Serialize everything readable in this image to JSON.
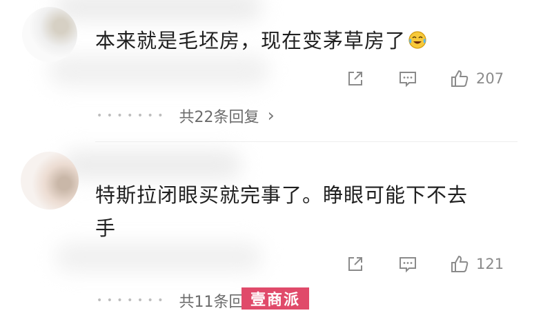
{
  "comments": [
    {
      "text": "本来就是毛坯房，现在变茅草房了",
      "emoji": "crying-laughing-emoji",
      "like_count": "207",
      "replies_label": "共22条回复",
      "chevron": "›"
    },
    {
      "text_line1": "特斯拉闭眼买就完事了。睁眼可能下不去",
      "text_line2": "手",
      "like_count": "121",
      "replies_label": "共11条回复"
    }
  ],
  "watermark": {
    "text": "壹商派"
  },
  "icons": [
    "share-icon",
    "comment-icon",
    "like-icon",
    "chevron-right-icon",
    "crying-laughing-emoji"
  ]
}
